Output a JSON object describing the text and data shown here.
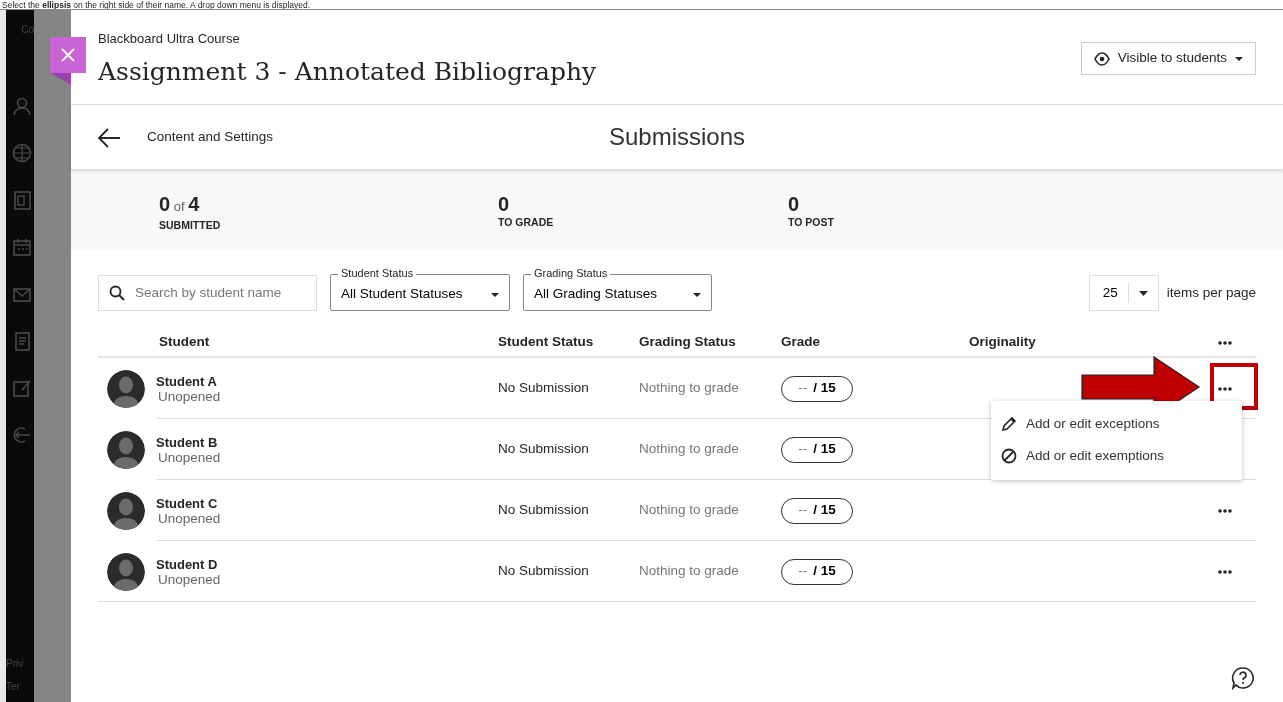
{
  "instruction": "Select the **ellipsis** on the right side of their name. A drop down menu is displayed.",
  "background": {
    "top_text": "Co",
    "bottom_texts": [
      "Priv",
      "Ter"
    ]
  },
  "header": {
    "course": "Blackboard Ultra Course",
    "title": "Assignment 3 - Annotated Bibliography",
    "visibility": "Visible to students"
  },
  "nav": {
    "back_label": "Content and Settings",
    "title": "Submissions"
  },
  "stats": [
    {
      "value": "0",
      "of": "of",
      "total": "4",
      "label": "SUBMITTED"
    },
    {
      "value": "0",
      "label": "TO GRADE"
    },
    {
      "value": "0",
      "label": "TO POST"
    }
  ],
  "filters": {
    "search": {
      "placeholder": "Search by student name"
    },
    "selects": [
      {
        "label": "Student Status",
        "value": "All Student Statuses"
      },
      {
        "label": "Grading Status",
        "value": "All Grading Statuses"
      }
    ],
    "page_size": "25",
    "page_size_label": "items per page"
  },
  "table": {
    "columns": [
      "Student",
      "Student Status",
      "Grading Status",
      "Grade",
      "Originality"
    ],
    "rows": [
      {
        "name": "Student A",
        "access": "Unopened",
        "student_status": "No Submission",
        "grading_status": "Nothing to grade",
        "grade": "--",
        "grade_max": "/ 15",
        "menu_open": true,
        "highlighted": true
      },
      {
        "name": "Student B",
        "access": "Unopened",
        "student_status": "No Submission",
        "grading_status": "Nothing to grade",
        "grade": "--",
        "grade_max": "/ 15",
        "menu_open": false,
        "highlighted": false
      },
      {
        "name": "Student C",
        "access": "Unopened",
        "student_status": "No Submission",
        "grading_status": "Nothing to grade",
        "grade": "--",
        "grade_max": "/ 15",
        "menu_open": false,
        "highlighted": false
      },
      {
        "name": "Student D",
        "access": "Unopened",
        "student_status": "No Submission",
        "grading_status": "Nothing to grade",
        "grade": "--",
        "grade_max": "/ 15",
        "menu_open": false,
        "highlighted": false
      }
    ]
  },
  "menu": {
    "items": [
      {
        "kind": "edit",
        "label": "Add or edit exceptions"
      },
      {
        "kind": "exempt",
        "label": "Add or edit exemptions"
      }
    ]
  }
}
